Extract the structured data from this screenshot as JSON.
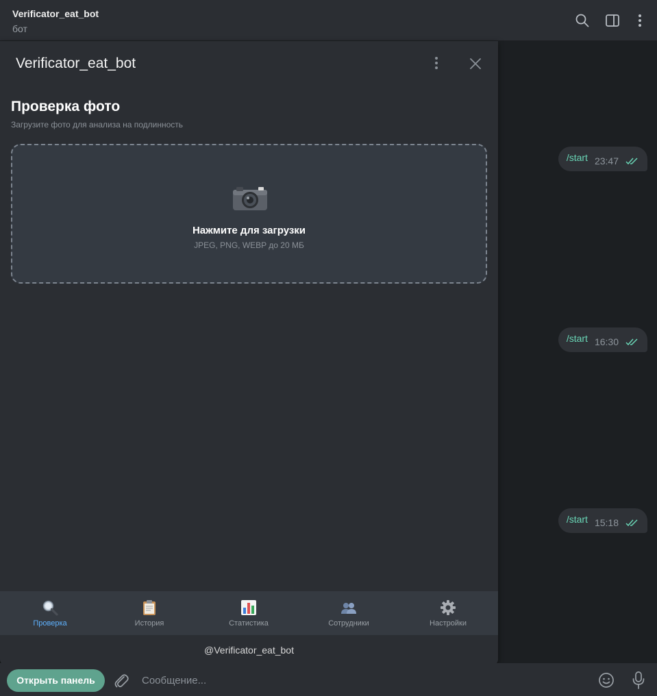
{
  "window": {
    "title": "Verificator_eat_bot",
    "subtitle": "бот"
  },
  "messages": [
    {
      "text": "/start",
      "time": "23:47"
    },
    {
      "text": "/start",
      "time": "16:30"
    },
    {
      "text": "/start",
      "time": "15:18"
    }
  ],
  "panel": {
    "title": "Verificator_eat_bot",
    "footer": "@Verificator_eat_bot"
  },
  "webapp": {
    "heading": "Проверка фото",
    "subheading": "Загрузите фото для анализа на подлинность",
    "upload": {
      "title": "Нажмите для загрузки",
      "hint": "JPEG, PNG, WEBP до 20 МБ",
      "icon": "camera-icon"
    },
    "tabs": [
      {
        "label": "Проверка",
        "icon": "magnifier-icon",
        "active": true
      },
      {
        "label": "История",
        "icon": "clipboard-icon",
        "active": false
      },
      {
        "label": "Статистика",
        "icon": "bar-chart-icon",
        "active": false
      },
      {
        "label": "Сотрудники",
        "icon": "people-icon",
        "active": false
      },
      {
        "label": "Настройки",
        "icon": "gear-icon",
        "active": false
      }
    ]
  },
  "composer": {
    "open_panel_label": "Открыть панель",
    "placeholder": "Сообщение..."
  },
  "colors": {
    "accent_green": "#5fa38e",
    "tick_green": "#6ad7b7",
    "active_tab_blue": "#5fb2ff"
  }
}
